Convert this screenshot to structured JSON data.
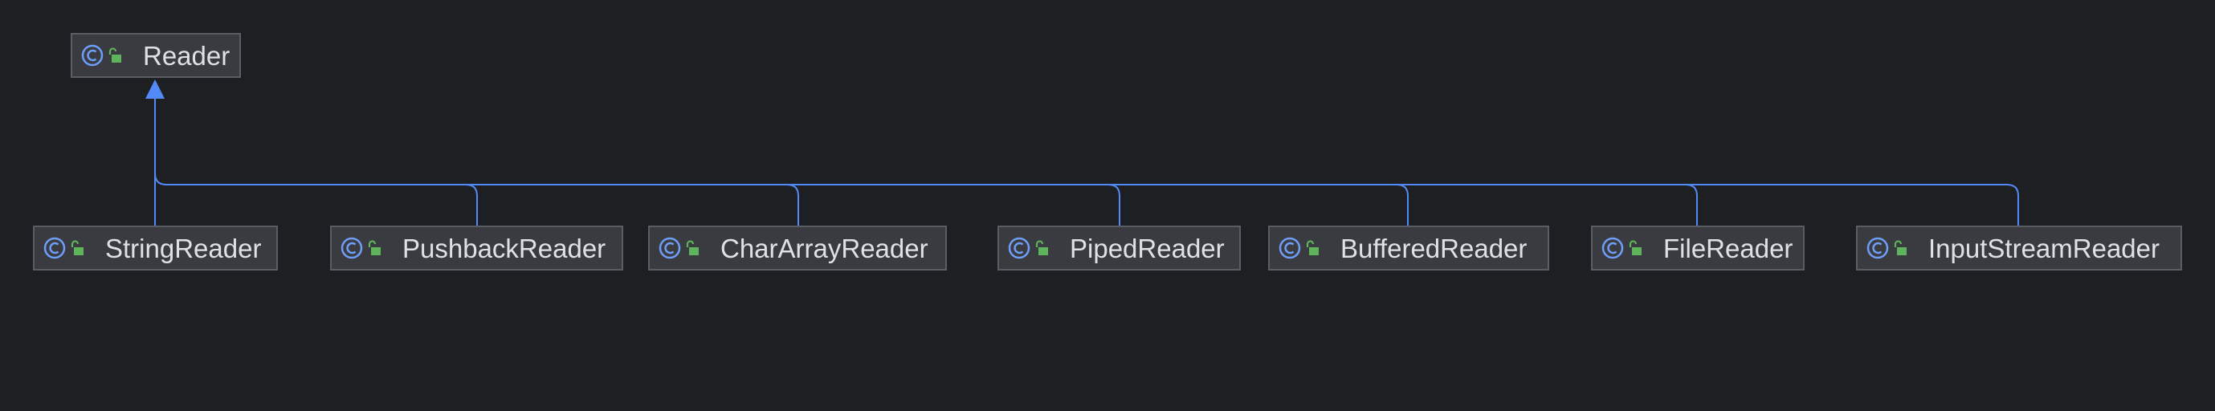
{
  "diagram": {
    "edge_color": "#548af7",
    "parent": {
      "label": "Reader",
      "icon": "class-icon",
      "badge": "public-lock-icon"
    },
    "children": [
      {
        "label": "StringReader",
        "icon": "class-icon",
        "badge": "public-lock-icon"
      },
      {
        "label": "PushbackReader",
        "icon": "class-icon",
        "badge": "public-lock-icon"
      },
      {
        "label": "CharArrayReader",
        "icon": "class-icon",
        "badge": "public-lock-icon"
      },
      {
        "label": "PipedReader",
        "icon": "class-icon",
        "badge": "public-lock-icon"
      },
      {
        "label": "BufferedReader",
        "icon": "class-icon",
        "badge": "public-lock-icon"
      },
      {
        "label": "FileReader",
        "icon": "class-icon",
        "badge": "public-lock-icon"
      },
      {
        "label": "InputStreamReader",
        "icon": "class-icon",
        "badge": "public-lock-icon"
      }
    ]
  }
}
